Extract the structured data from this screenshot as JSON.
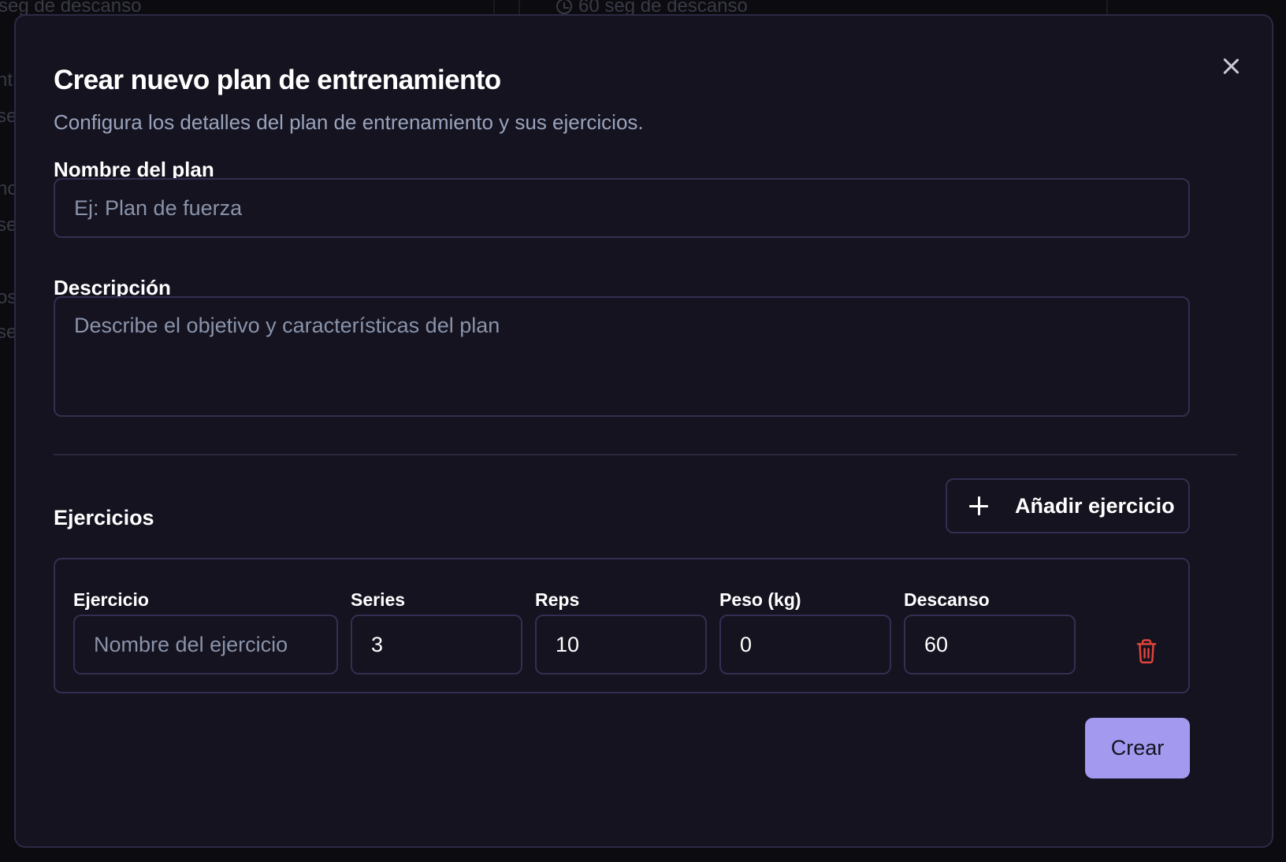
{
  "background": {
    "rest_left": "seg de descanso",
    "rest_right": "60 seg de descanso",
    "fragments": [
      "nt",
      "se",
      "no",
      "se",
      "os",
      "se"
    ]
  },
  "modal": {
    "title": "Crear nuevo plan de entrenamiento",
    "subtitle": "Configura los detalles del plan de entrenamiento y sus ejercicios.",
    "name_label": "Nombre del plan",
    "name_placeholder": "Ej: Plan de fuerza",
    "name_value": "",
    "description_label": "Descripción",
    "description_placeholder": "Describe el objetivo y características del plan",
    "description_value": "",
    "exercises_title": "Ejercicios",
    "add_exercise_label": "Añadir ejercicio",
    "exercise_columns": {
      "exercise": "Ejercicio",
      "series": "Series",
      "reps": "Reps",
      "weight": "Peso (kg)",
      "rest": "Descanso"
    },
    "exercise_row": {
      "name_placeholder": "Nombre del ejercicio",
      "name": "",
      "series": "3",
      "reps": "10",
      "weight": "0",
      "rest": "60"
    },
    "create_label": "Crear"
  },
  "colors": {
    "modal_bg": "#14131f",
    "border": "#322f52",
    "primary": "#a39af0",
    "danger": "#e0443a"
  },
  "icons": [
    "close-icon",
    "plus-icon",
    "trash-icon",
    "clock-icon"
  ]
}
